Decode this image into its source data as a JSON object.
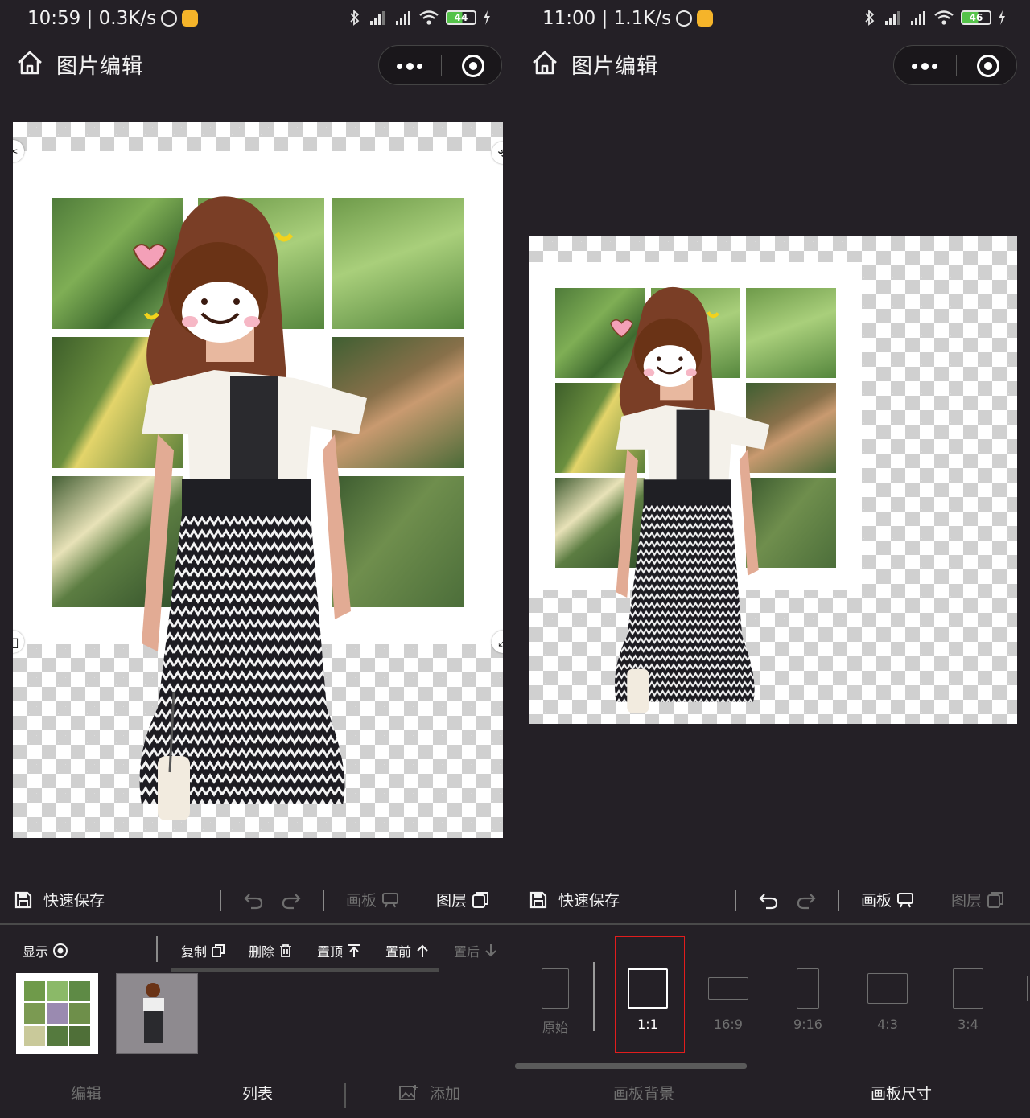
{
  "left": {
    "status": {
      "time_speed": "10:59 | 0.3K/s",
      "battery": "44"
    },
    "title": "图片编辑",
    "toolbar": {
      "quick_save": "快速保存",
      "board": "画板",
      "layers": "图层"
    },
    "ops": {
      "show": "显示",
      "copy": "复制",
      "delete": "删除",
      "top": "置顶",
      "forward": "置前",
      "backward": "置后"
    },
    "tabs": {
      "edit": "编辑",
      "list": "列表",
      "add": "添加"
    }
  },
  "right": {
    "status": {
      "time_speed": "11:00 | 1.1K/s",
      "battery": "46"
    },
    "title": "图片编辑",
    "toolbar": {
      "quick_save": "快速保存",
      "board": "画板",
      "layers": "图层"
    },
    "ratios": [
      "原始",
      "1:1",
      "16:9",
      "9:16",
      "4:3",
      "3:4"
    ],
    "selected_ratio": "1:1",
    "tabs": {
      "background": "画板背景",
      "size": "画板尺寸"
    }
  },
  "icons": [
    "home-icon",
    "more-icon",
    "target-icon",
    "save-icon",
    "undo-icon",
    "redo-icon",
    "board-icon",
    "layers-icon",
    "eye-icon",
    "copy-icon",
    "trash-icon",
    "top-icon",
    "arrow-up-icon",
    "arrow-down-icon",
    "add-image-icon",
    "scissors-icon",
    "rotate-icon",
    "flip-icon",
    "expand-icon"
  ],
  "colors": {
    "background": "#242026",
    "highlight": "#e21d1d"
  }
}
